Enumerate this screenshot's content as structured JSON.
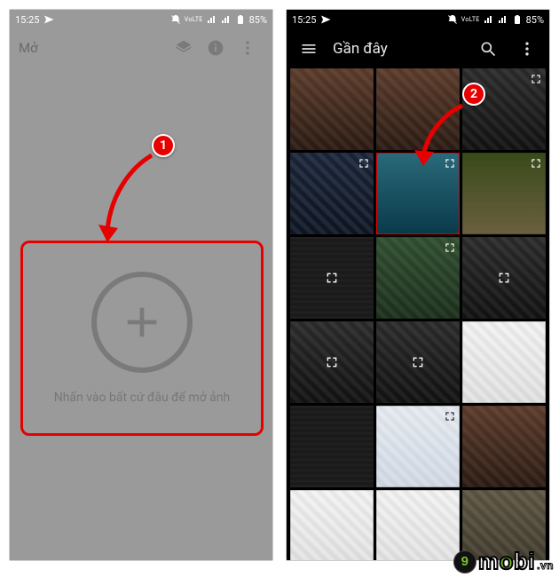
{
  "status": {
    "time": "15:25",
    "net_label": "VoLTE",
    "battery": "85%"
  },
  "screen1": {
    "title": "Mở",
    "hint": "Nhấn vào bất cứ đâu để mở ảnh"
  },
  "screen2": {
    "title": "Gần đây"
  },
  "callouts": {
    "one": "1",
    "two": "2"
  },
  "watermark": {
    "vn": ".vn",
    "nine": "9"
  }
}
